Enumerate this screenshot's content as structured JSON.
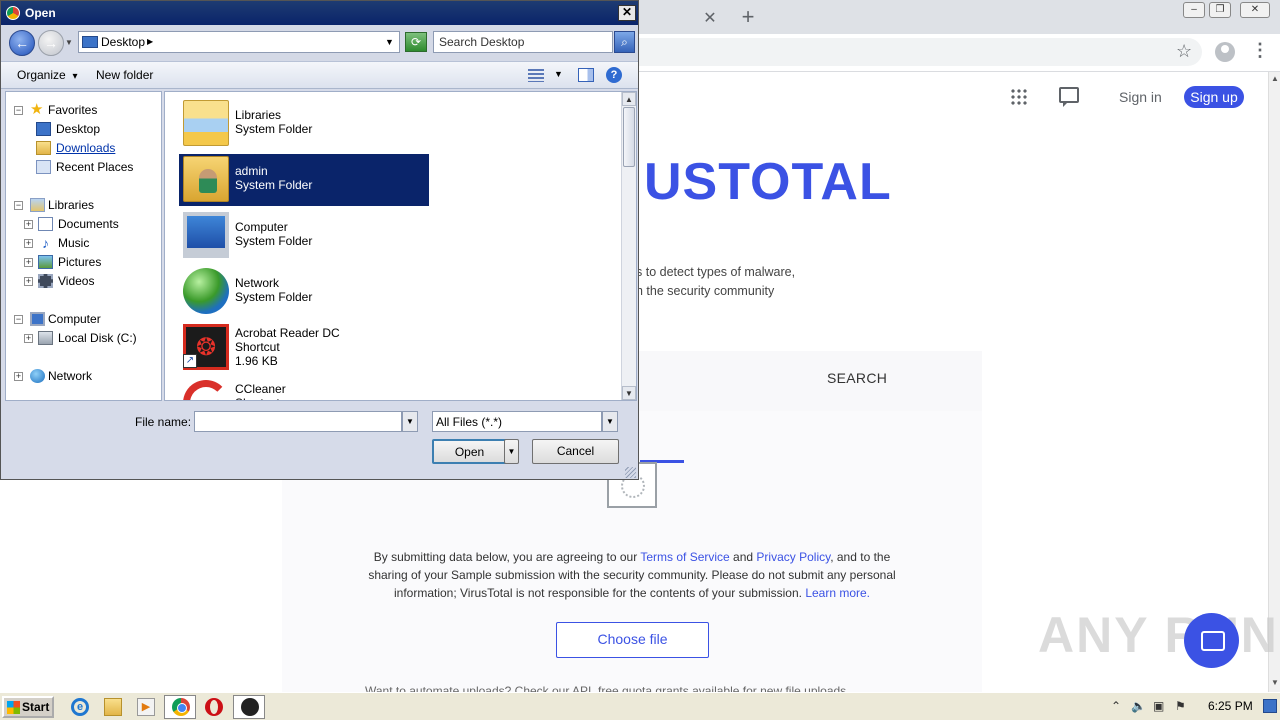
{
  "browser": {
    "signin": "Sign in",
    "signup": "Sign up",
    "logo_visible": "USTOTAL",
    "tagline_1": "s to detect types of malware,",
    "tagline_2": "h the security community",
    "search_tab": "SEARCH",
    "legal_1_pre": "By submitting data below, you are agreeing to our ",
    "legal_terms": "Terms of Service",
    "legal_and": " and ",
    "legal_privacy": "Privacy Policy",
    "legal_1_post": ", and to the",
    "legal_2": "sharing of your Sample submission with the security community. Please do not submit any personal",
    "legal_3_pre": "information; VirusTotal is not responsible for the contents of your submission. ",
    "legal_learn": "Learn more.",
    "choose_file": "Choose file",
    "api_line": "Want to automate uploads? Check our API, free quota grants available for new file uploads",
    "watermark": "ANY RUN",
    "accent_color": "#3b52e4"
  },
  "dialog": {
    "title": "Open",
    "close_glyph": "✕",
    "location": "Desktop",
    "search_placeholder": "Search Desktop",
    "organize": "Organize",
    "new_folder": "New folder",
    "help_glyph": "?",
    "nav_tree": [
      {
        "label": "Favorites",
        "icon": "star-icon"
      },
      {
        "label": "Desktop",
        "icon": "desktop-icon"
      },
      {
        "label": "Downloads",
        "icon": "downloads-folder-icon"
      },
      {
        "label": "Recent Places",
        "icon": "recent-places-icon"
      },
      {
        "label": "Libraries",
        "icon": "libraries-icon"
      },
      {
        "label": "Documents",
        "icon": "documents-icon"
      },
      {
        "label": "Music",
        "icon": "music-icon"
      },
      {
        "label": "Pictures",
        "icon": "pictures-icon"
      },
      {
        "label": "Videos",
        "icon": "videos-icon"
      },
      {
        "label": "Computer",
        "icon": "computer-icon"
      },
      {
        "label": "Local Disk (C:)",
        "icon": "local-disk-icon"
      },
      {
        "label": "Network",
        "icon": "network-icon"
      }
    ],
    "files": [
      {
        "name": "Libraries",
        "type": "System Folder",
        "size": ""
      },
      {
        "name": "admin",
        "type": "System Folder",
        "size": ""
      },
      {
        "name": "Computer",
        "type": "System Folder",
        "size": ""
      },
      {
        "name": "Network",
        "type": "System Folder",
        "size": ""
      },
      {
        "name": "Acrobat Reader DC",
        "type": "Shortcut",
        "size": "1.96 KB"
      },
      {
        "name": "CCleaner",
        "type": "Shortcut",
        "size": ""
      }
    ],
    "selected_file": "admin",
    "file_name_label": "File name:",
    "file_name_value": "",
    "filter": "All Files (*.*)",
    "open": "Open",
    "cancel": "Cancel"
  },
  "taskbar": {
    "start": "Start",
    "clock": "6:25 PM"
  }
}
